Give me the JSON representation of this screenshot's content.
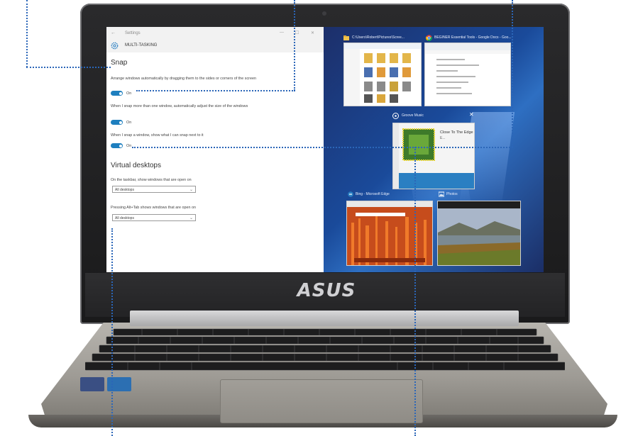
{
  "brand": "ASUS",
  "settings": {
    "window_title": "Settings",
    "window_controls": [
      "—",
      "☐",
      "✕"
    ],
    "back_glyph": "←",
    "page_title": "MULTI-TASKING",
    "snap": {
      "heading": "Snap",
      "option1": "Arrange windows automatically by dragging them to the sides or corners of the screen",
      "option1_state": "On",
      "option2": "When I snap more than one window, automatically adjust the size of the windows",
      "option2_state": "On",
      "option3": "When I snap a window, show what I can snap next to it",
      "option3_state": "On"
    },
    "virtual_desktops": {
      "heading": "Virtual desktops",
      "label1": "On the taskbar, show windows that are open on",
      "value1": "All desktops",
      "label2": "Pressing Alt+Tab shows windows that are open on",
      "value2": "All desktops"
    }
  },
  "taskview": {
    "window1_title": "C:\\Users\\Robert\\Pictures\\Scree...",
    "window2_title": "BEGINER Essential Tools - Google Docs - Goo...",
    "window3_title": "Groove Music",
    "window3_song": "Close To The Edge",
    "window3_artist": "E...",
    "window4_title": "Bing - Microsoft Edge",
    "window5_title": "Photos"
  },
  "colors": {
    "accent": "#1e7fbf",
    "callout": "#2b66b8",
    "desktop": "#1a4a9a"
  },
  "icons": {
    "settings_gear": "gear-icon",
    "folder": "folder-icon",
    "chrome": "chrome-icon",
    "groove": "groove-music-icon",
    "edge": "edge-icon",
    "photos": "photos-icon"
  }
}
